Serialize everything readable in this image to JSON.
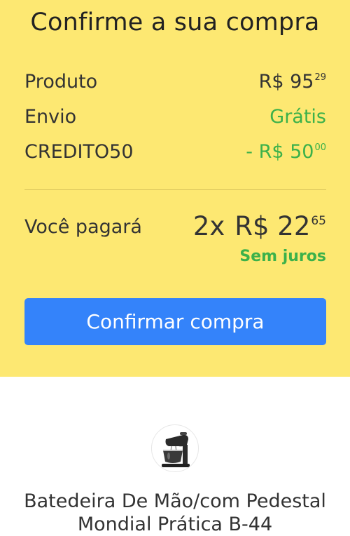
{
  "summary": {
    "title": "Confirme a sua compra",
    "rows": [
      {
        "label": "Produto",
        "value": "R$ 95",
        "cents": "29"
      },
      {
        "label": "Envio",
        "value": "Grátis",
        "cents": ""
      },
      {
        "label": "CREDITO50",
        "value": "- R$ 50",
        "cents": "00"
      }
    ],
    "payment": {
      "label": "Você pagará",
      "installments": "2x",
      "amount": "R$ 22",
      "cents": "65",
      "interest_note": "Sem juros"
    },
    "confirm_button": "Confirmar compra"
  },
  "product": {
    "image_icon": "stand-mixer-icon",
    "name": "Batedeira De Mão/com Pedestal Mondial Prática B-44"
  },
  "colors": {
    "summary_background": "#fde872",
    "button": "#3483fa",
    "positive": "#3cb14a"
  }
}
